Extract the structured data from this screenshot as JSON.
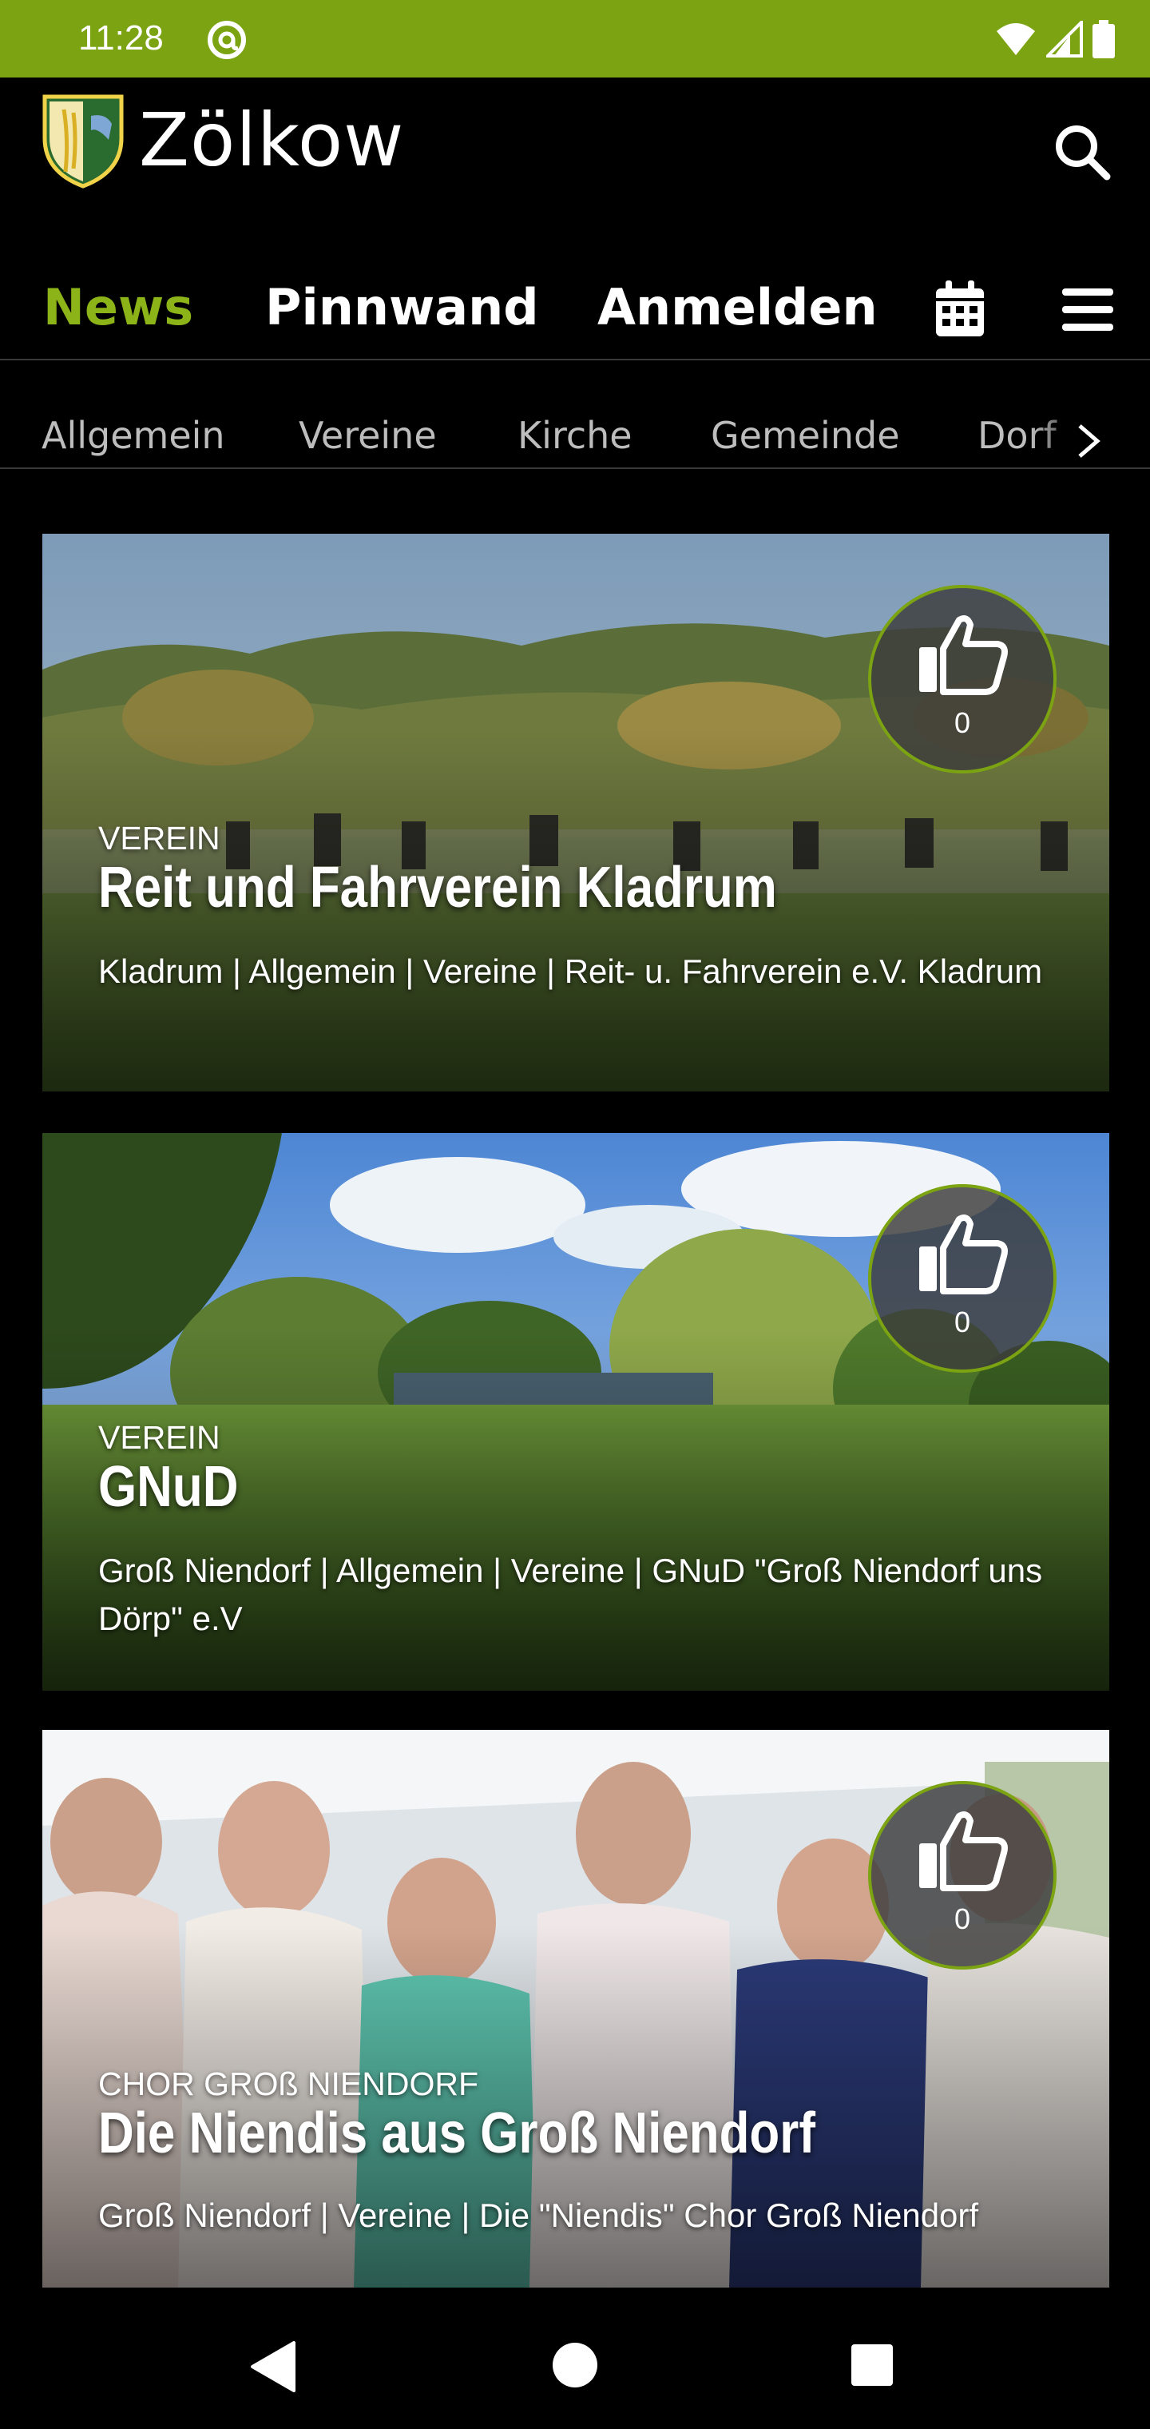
{
  "status_bar": {
    "time": "11:28",
    "background": "#7ba312"
  },
  "header": {
    "app_name": "Zölkow",
    "search_icon": "search-icon"
  },
  "nav": {
    "items": [
      {
        "label": "News",
        "active": true
      },
      {
        "label": "Pinnwand",
        "active": false
      },
      {
        "label": "Anmelden",
        "active": false
      }
    ],
    "calendar_icon": "calendar-icon",
    "menu_icon": "hamburger-menu-icon",
    "accent": "#8cb318"
  },
  "categories": [
    "Allgemein",
    "Vereine",
    "Kirche",
    "Gemeinde",
    "Dorf"
  ],
  "cards": [
    {
      "category": "VEREIN",
      "title": "Reit und Fahrverein Kladrum",
      "meta": "Kladrum | Allgemein | Vereine | Reit- u. Fahrverein e.V. Kladrum",
      "likes": "0"
    },
    {
      "category": "VEREIN",
      "title": "GNuD",
      "meta": "Groß Niendorf | Allgemein | Vereine | GNuD \"Groß Niendorf uns Dörp\" e.V",
      "likes": "0"
    },
    {
      "category": "CHOR GROß NIENDORF",
      "title": "Die Niendis aus Groß Niendorf",
      "meta": "Groß Niendorf | Vereine | Die \"Niendis\" Chor Groß Niendorf",
      "likes": "0"
    }
  ]
}
